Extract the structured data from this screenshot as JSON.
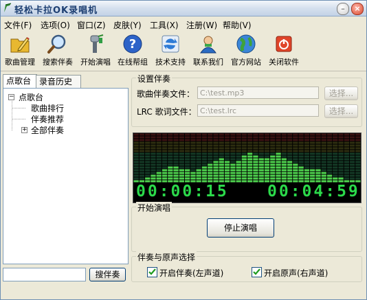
{
  "window": {
    "title": "轻松卡拉OK录唱机"
  },
  "menu": [
    {
      "label": "文件(F)"
    },
    {
      "label": "选项(O)"
    },
    {
      "label": "窗口(Z)"
    },
    {
      "label": "皮肤(Y)"
    },
    {
      "label": "工具(X)"
    },
    {
      "label": "注册(W)"
    },
    {
      "label": "帮助(V)"
    }
  ],
  "toolbar": [
    {
      "label": "歌曲管理",
      "icon": "folder-pencil-icon"
    },
    {
      "label": "搜索伴奏",
      "icon": "magnifier-icon"
    },
    {
      "label": "开始演唱",
      "icon": "microphone-icon"
    },
    {
      "label": "在线帮组",
      "icon": "help-icon"
    },
    {
      "label": "技术支持",
      "icon": "sync-icon"
    },
    {
      "label": "联系我们",
      "icon": "contact-person-icon"
    },
    {
      "label": "官方网站",
      "icon": "globe-icon"
    },
    {
      "label": "关闭软件",
      "icon": "power-icon"
    }
  ],
  "tabs": [
    {
      "label": "点歌台"
    },
    {
      "label": "录音历史"
    }
  ],
  "tree": {
    "root": "点歌台",
    "children": [
      "歌曲排行",
      "伴奏推荐",
      "全部伴奏"
    ]
  },
  "search": {
    "value": "",
    "button": "搜伴奏"
  },
  "settings": {
    "group_title": "设置伴奏",
    "song_label": "歌曲伴奏文件：",
    "song_value": "C:\\test.mp3",
    "lrc_label": "LRC 歌词文件：",
    "lrc_value": "C:\\test.lrc",
    "browse_label": "选择..."
  },
  "visualizer": {
    "elapsed": "00:00:15",
    "total": "00:04:59",
    "levels": [
      0.05,
      0.08,
      0.12,
      0.15,
      0.2,
      0.28,
      0.32,
      0.35,
      0.3,
      0.26,
      0.24,
      0.3,
      0.35,
      0.4,
      0.45,
      0.5,
      0.42,
      0.38,
      0.44,
      0.55,
      0.6,
      0.58,
      0.52,
      0.48,
      0.55,
      0.6,
      0.52,
      0.45,
      0.4,
      0.35,
      0.3,
      0.28,
      0.25,
      0.2,
      0.15,
      0.12,
      0.1,
      0.08,
      0.06,
      0.05
    ]
  },
  "sing": {
    "group_title": "开始演唱",
    "button": "停止演唱"
  },
  "options": {
    "group_title": "伴奏与原声选择",
    "accomp_label": "开启伴奏(左声道)",
    "accomp_checked": true,
    "orig_label": "开启原声(右声道)",
    "orig_checked": true
  }
}
